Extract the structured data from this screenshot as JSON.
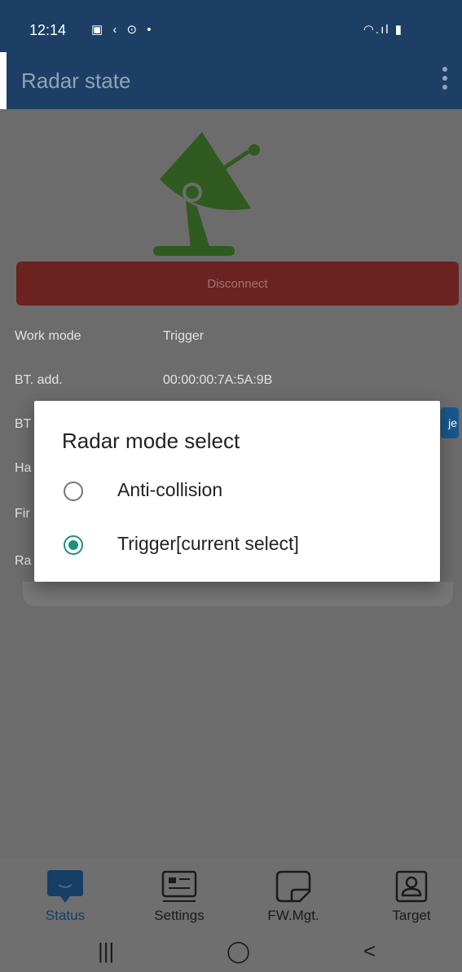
{
  "status_bar": {
    "time": "12:14",
    "left_icons": "▣ ‹ ⊙ •",
    "right_icons": "◠.ıl ▮"
  },
  "app_bar": {
    "title": "Radar state"
  },
  "main": {
    "disconnect_label": "Disconnect",
    "rows": [
      {
        "label": "Work mode",
        "value": "Trigger"
      },
      {
        "label": "BT. add.",
        "value": "00:00:00:7A:5A:9B"
      },
      {
        "label": "BT",
        "value": ""
      },
      {
        "label": "Ha",
        "value": ""
      },
      {
        "label": "Fir",
        "value": ""
      },
      {
        "label": "Ra",
        "value": ""
      }
    ],
    "side_button_fragment": "je"
  },
  "dialog": {
    "title": "Radar mode select",
    "options": [
      {
        "label": "Anti-collision",
        "selected": false
      },
      {
        "label": "Trigger[current select]",
        "selected": true
      }
    ]
  },
  "bottom_nav": {
    "tabs": [
      {
        "label": "Status",
        "active": true
      },
      {
        "label": "Settings",
        "active": false
      },
      {
        "label": "FW.Mgt.",
        "active": false
      },
      {
        "label": "Target",
        "active": false
      }
    ]
  },
  "system_nav": {
    "recents": "|||",
    "home": "◯",
    "back": "<"
  },
  "colors": {
    "primary": "#1d3f66",
    "radar_green": "#2f5a20",
    "disconnect": "#6a2321",
    "radio_accent": "#1f8e7d"
  }
}
